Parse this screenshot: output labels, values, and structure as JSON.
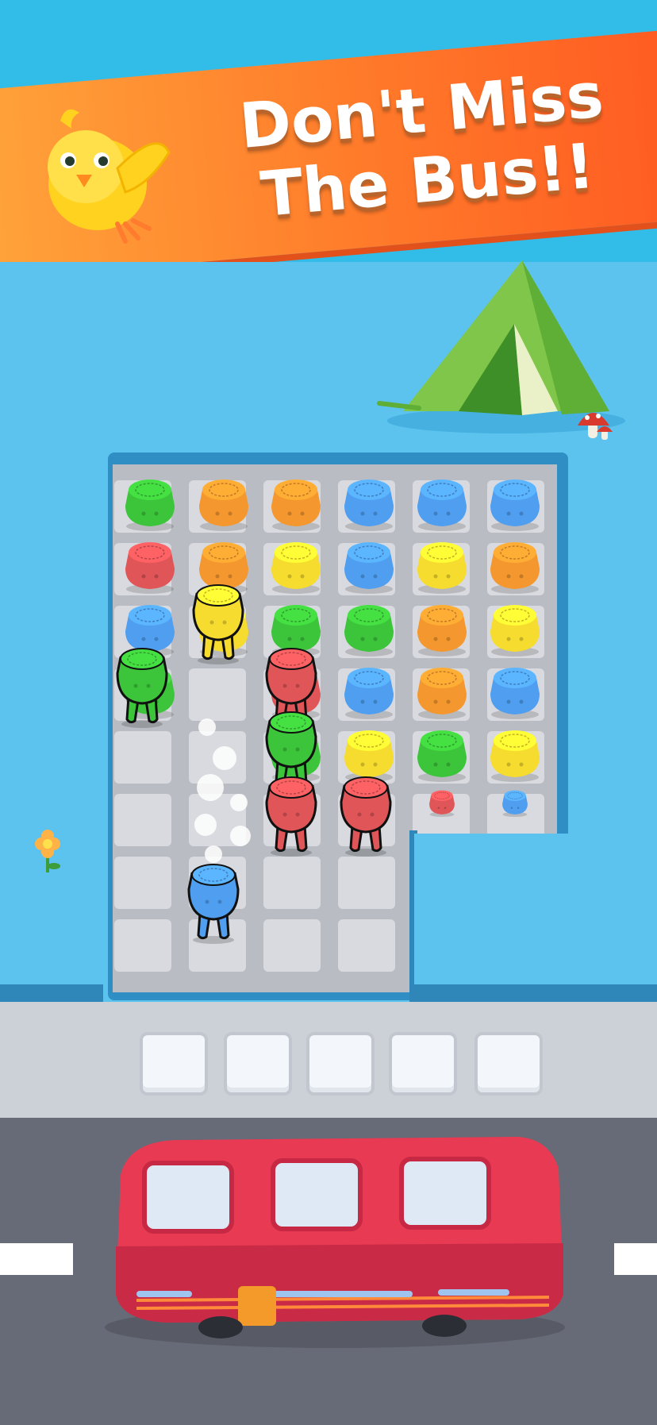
{
  "banner": {
    "line1": "Don't Miss",
    "line2": "The Bus!!"
  },
  "colors": {
    "green": "#3cc43a",
    "orange": "#f4972e",
    "blue": "#4f9ef0",
    "red": "#e05557",
    "yellow": "#f6dc2e",
    "bus": "#e83a52",
    "banner": "#ff7a2a"
  },
  "board": {
    "seated_rows": [
      [
        "green",
        "orange",
        "orange",
        "blue",
        "blue",
        "blue"
      ],
      [
        "red",
        "orange",
        "yellow",
        "blue",
        "yellow",
        "orange"
      ],
      [
        "blue",
        "yellow",
        "green",
        "green",
        "orange",
        "yellow"
      ],
      [
        "green",
        "empty",
        "red",
        "blue",
        "orange",
        "blue"
      ],
      [
        "empty",
        "empty",
        "green",
        "yellow",
        "green",
        "yellow"
      ],
      [
        "empty",
        "empty",
        "red",
        "red",
        "red",
        "blue"
      ]
    ],
    "standing_passengers": [
      {
        "color": "yellow"
      },
      {
        "color": "green"
      },
      {
        "color": "red"
      },
      {
        "color": "green"
      },
      {
        "color": "red"
      },
      {
        "color": "red"
      },
      {
        "color": "blue"
      }
    ]
  },
  "waiting_slots": [
    {
      "occupied": false
    },
    {
      "occupied": false
    },
    {
      "occupied": false
    },
    {
      "occupied": false
    },
    {
      "occupied": false
    }
  ],
  "bus": {
    "color_name": "red",
    "seats_filled": 0,
    "windows": 3
  },
  "icons": {
    "mascot": "chick-mascot-icon",
    "tent": "tent-icon",
    "mushroom": "mushroom-icon",
    "flower": "flower-icon"
  }
}
